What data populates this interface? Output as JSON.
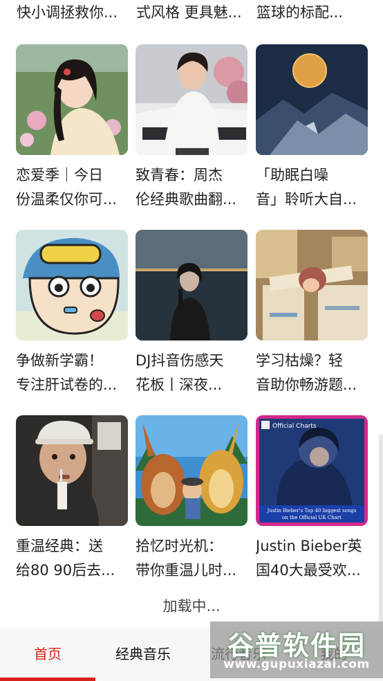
{
  "top_row": [
    {
      "caption": "快小调拯救你..."
    },
    {
      "caption": "式风格 更具魅..."
    },
    {
      "caption": "篮球的标配..."
    }
  ],
  "playlists": [
    {
      "line1": "恋爱季｜今日",
      "line2": "份温柔仅你可..."
    },
    {
      "line1": "致青春：周杰",
      "line2": "伦经典歌曲翻..."
    },
    {
      "line1": "「助眠白噪",
      "line2": "音」聆听大自..."
    },
    {
      "line1": "争做新学霸！",
      "line2": "专注肝试卷的..."
    },
    {
      "line1": "DJ抖音伤感天",
      "line2": "花板丨深夜..."
    },
    {
      "line1": "学习枯燥？轻",
      "line2": "音助你畅游题..."
    },
    {
      "line1": "重温经典：送",
      "line2": "给80 90后去..."
    },
    {
      "line1": "拾忆时光机：",
      "line2": "带你重温儿时..."
    },
    {
      "line1": "Justin Bieber英",
      "line2": "国40大最受欢..."
    }
  ],
  "bieber_cover": {
    "badge": "Official Charts",
    "text_line1": "Justin Bieber's Top 40 biggest songs",
    "text_line2": "on the Official UK Chart"
  },
  "loading_text": "加载中...",
  "bottom_nav": {
    "items": [
      "首页",
      "经典音乐",
      "流行音乐",
      "我的"
    ],
    "active_index": 0
  },
  "watermark": {
    "title": "谷普软件园",
    "url": "www.gupuxiazai.com"
  },
  "colors": {
    "accent": "#d8231b",
    "text": "#222222",
    "nav_bg": "#f7f7f7"
  }
}
